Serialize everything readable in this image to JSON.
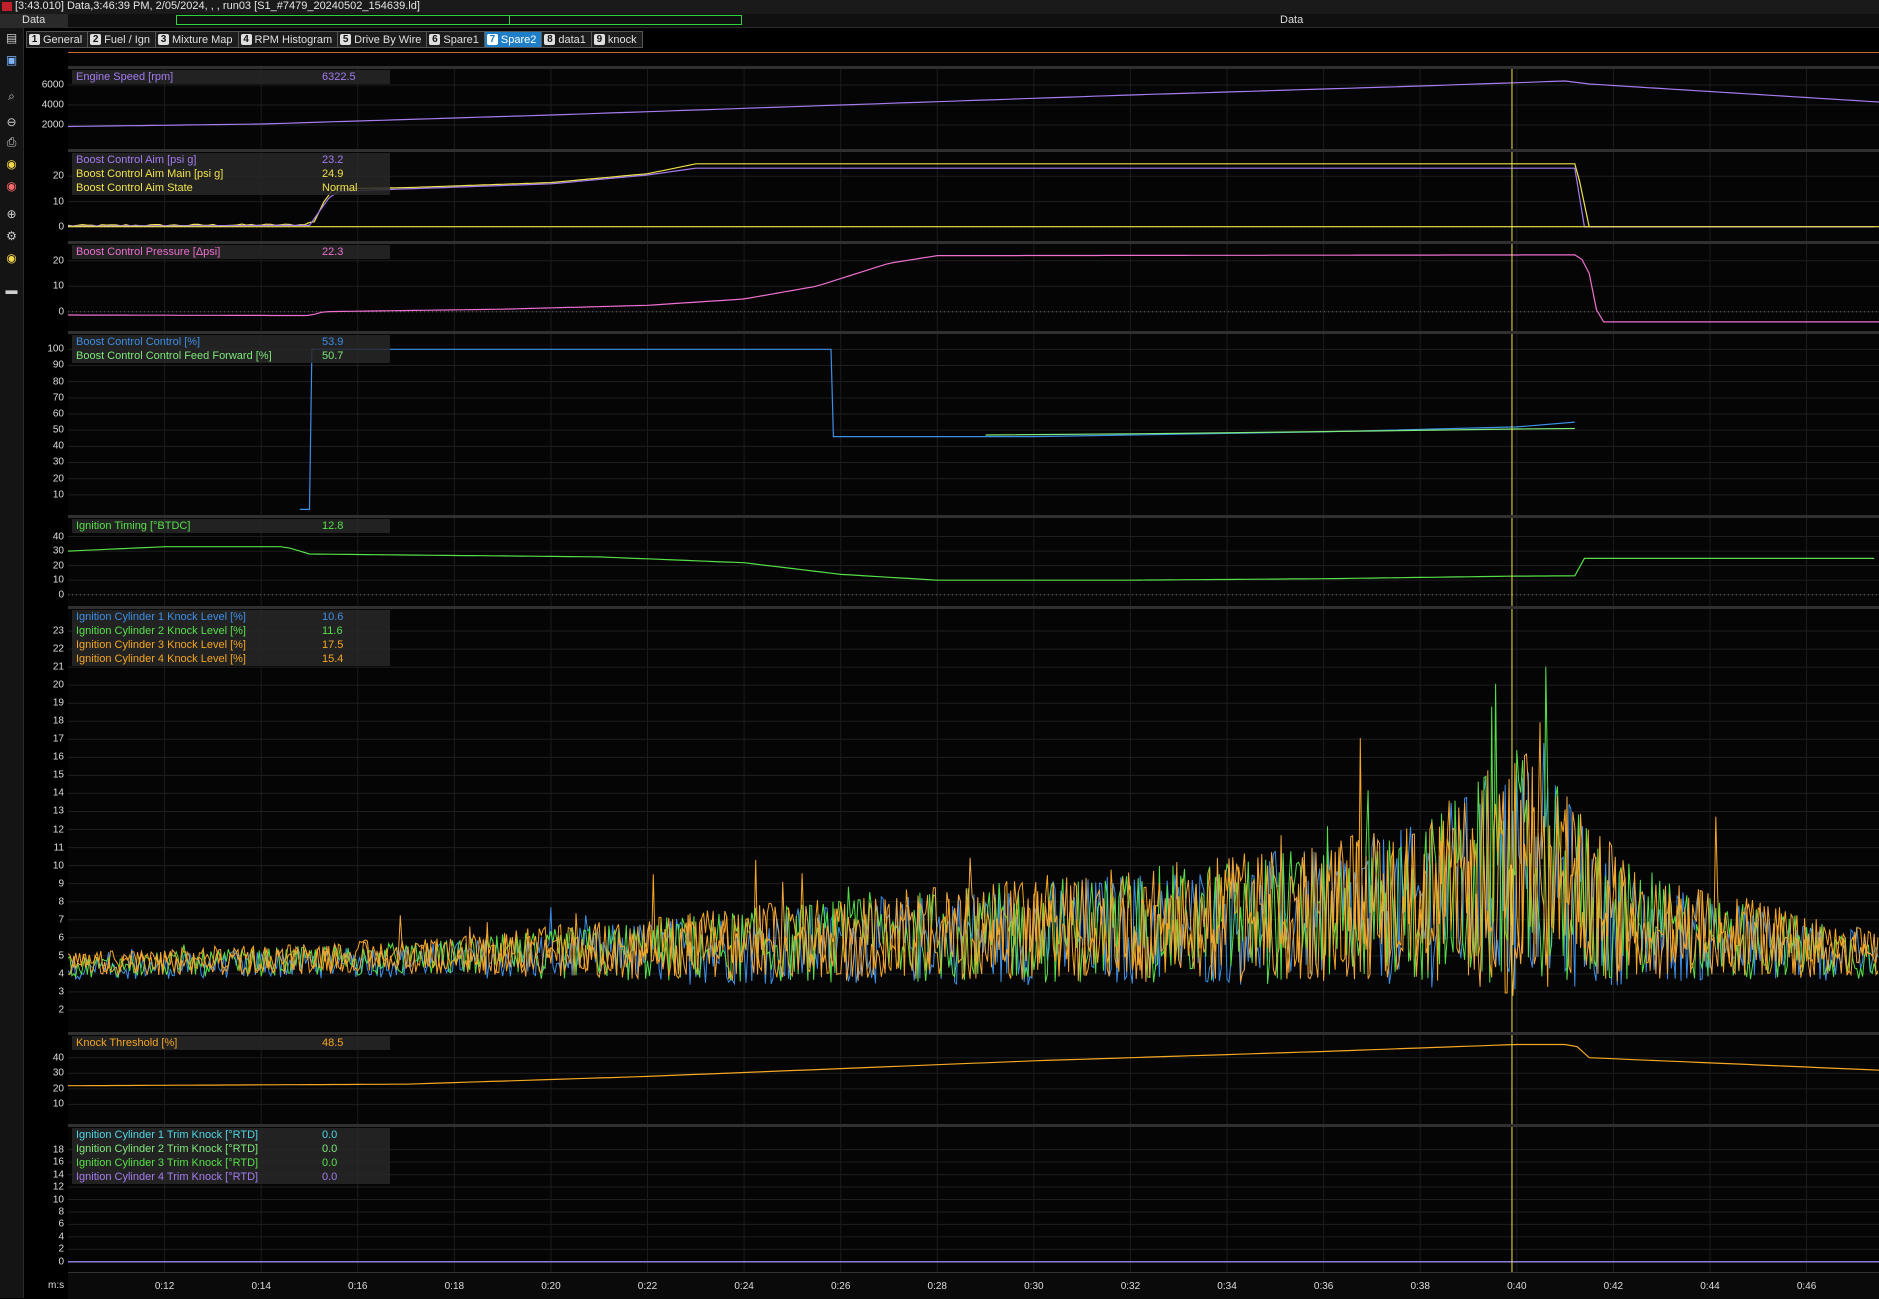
{
  "window": {
    "title": "[3:43.010] Data,3:46:39 PM, 2/05/2024,  , , run03 [S1_#7479_20240502_154639.ld]"
  },
  "databar": {
    "left_label": "Data",
    "center_label": "Data"
  },
  "tabs": [
    {
      "num": "1",
      "label": "General"
    },
    {
      "num": "2",
      "label": "Fuel / Ign"
    },
    {
      "num": "3",
      "label": "Mixture Map"
    },
    {
      "num": "4",
      "label": "RPM Histogram"
    },
    {
      "num": "5",
      "label": "Drive By Wire"
    },
    {
      "num": "6",
      "label": "Spare1"
    },
    {
      "num": "7",
      "label": "Spare2",
      "active": true
    },
    {
      "num": "8",
      "label": "data1"
    },
    {
      "num": "9",
      "label": "knock"
    }
  ],
  "toolbar": {
    "icons": [
      "workbook-icon",
      "overlay-icon",
      "zoom-search-icon",
      "zoom-out-icon",
      "print-icon",
      "properties-icon",
      "channel-icon",
      "math-icon",
      "settings-icon",
      "filter-icon",
      "highlight-icon",
      "timeline-icon"
    ]
  },
  "colors": {
    "purple": "#a47cf0",
    "yellow": "#f0e24a",
    "pink": "#ee6fd0",
    "blue": "#3d8fe6",
    "green": "#56e048",
    "light_green": "#7fe87a",
    "orange": "#f5a623",
    "cyan": "#4fd6e6",
    "cursor": "#f2e64a"
  },
  "x_axis": {
    "unit": "m:s",
    "ticks": [
      "0:12",
      "0:14",
      "0:16",
      "0:18",
      "0:20",
      "0:22",
      "0:24",
      "0:26",
      "0:28",
      "0:30",
      "0:32",
      "0:34",
      "0:36",
      "0:38",
      "0:40",
      "0:42",
      "0:44",
      "0:46"
    ]
  },
  "cursor": {
    "time": "0:39.9"
  },
  "panels": [
    {
      "id": "engine-speed",
      "y_ticks": [
        "6000",
        "4000",
        "2000"
      ],
      "legend": [
        {
          "name": "Engine Speed [rpm]",
          "value": "6322.5",
          "color": "#a47cf0"
        }
      ]
    },
    {
      "id": "boost-aim",
      "y_ticks": [
        "20",
        "10",
        "0"
      ],
      "legend": [
        {
          "name": "Boost Control Aim [psi g]",
          "value": "23.2",
          "color": "#a47cf0"
        },
        {
          "name": "Boost Control Aim Main [psi g]",
          "value": "24.9",
          "color": "#f0e24a"
        },
        {
          "name": "Boost Control Aim State",
          "value": "Normal",
          "color": "#f0e24a"
        }
      ]
    },
    {
      "id": "boost-pressure",
      "y_ticks": [
        "20",
        "10",
        "0"
      ],
      "legend": [
        {
          "name": "Boost Control Pressure [Δpsi]",
          "value": "22.3",
          "color": "#ee6fd0"
        }
      ]
    },
    {
      "id": "boost-control",
      "y_ticks": [
        "100",
        "90",
        "80",
        "70",
        "60",
        "50",
        "40",
        "30",
        "20",
        "10"
      ],
      "legend": [
        {
          "name": "Boost Control Control [%]",
          "value": "53.9",
          "color": "#3d8fe6"
        },
        {
          "name": "Boost Control Control Feed Forward [%]",
          "value": "50.7",
          "color": "#7fe87a"
        }
      ]
    },
    {
      "id": "ignition-timing",
      "y_ticks": [
        "40",
        "30",
        "20",
        "10",
        "0"
      ],
      "legend": [
        {
          "name": "Ignition Timing [°BTDC]",
          "value": "12.8",
          "color": "#56e048"
        }
      ]
    },
    {
      "id": "knock-level",
      "y_ticks": [
        "23",
        "22",
        "21",
        "20",
        "19",
        "18",
        "17",
        "16",
        "15",
        "14",
        "13",
        "12",
        "11",
        "10",
        "9",
        "8",
        "7",
        "6",
        "5",
        "4",
        "3",
        "2"
      ],
      "legend": [
        {
          "name": "Ignition Cylinder 1 Knock Level [%]",
          "value": "10.6",
          "color": "#3d8fe6"
        },
        {
          "name": "Ignition Cylinder 2 Knock Level [%]",
          "value": "11.6",
          "color": "#56e048"
        },
        {
          "name": "Ignition Cylinder 3 Knock Level [%]",
          "value": "17.5",
          "color": "#f5a623"
        },
        {
          "name": "Ignition Cylinder 4 Knock Level [%]",
          "value": "15.4",
          "color": "#f5a623"
        }
      ]
    },
    {
      "id": "knock-threshold",
      "y_ticks": [
        "40",
        "30",
        "20",
        "10"
      ],
      "legend": [
        {
          "name": "Knock Threshold [%]",
          "value": "48.5",
          "color": "#f5a623"
        }
      ]
    },
    {
      "id": "trim-knock",
      "y_ticks": [
        "18",
        "16",
        "14",
        "12",
        "10",
        "8",
        "6",
        "4",
        "2",
        "0"
      ],
      "legend": [
        {
          "name": "Ignition Cylinder 1 Trim Knock [°RTD]",
          "value": "0.0",
          "color": "#4fd6e6"
        },
        {
          "name": "Ignition Cylinder 2 Trim Knock [°RTD]",
          "value": "0.0",
          "color": "#7fe87a"
        },
        {
          "name": "Ignition Cylinder 3 Trim Knock [°RTD]",
          "value": "0.0",
          "color": "#56e048"
        },
        {
          "name": "Ignition Cylinder 4 Trim Knock [°RTD]",
          "value": "0.0",
          "color": "#a47cf0"
        }
      ]
    }
  ]
}
